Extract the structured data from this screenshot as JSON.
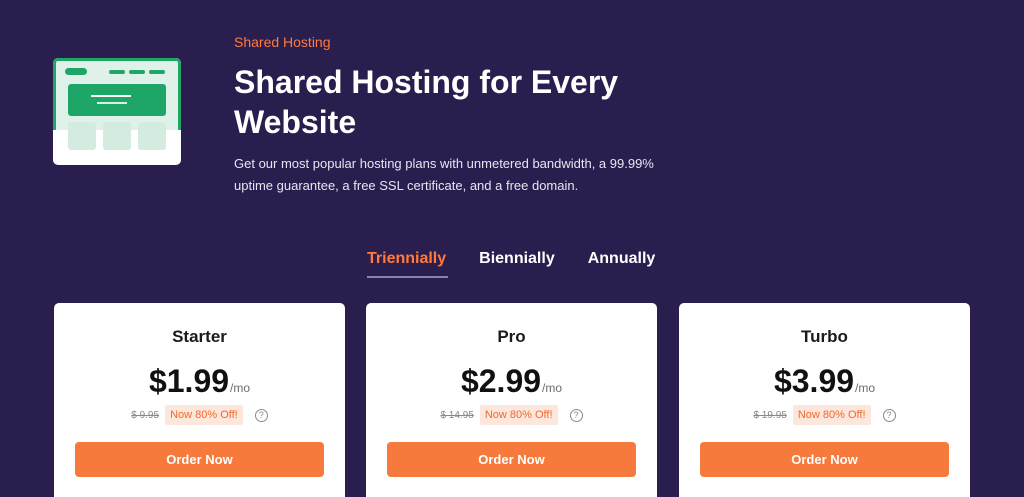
{
  "hero": {
    "eyebrow": "Shared Hosting",
    "title": "Shared Hosting for Every Website",
    "description": "Get our most popular hosting plans with unmetered bandwidth, a 99.99% uptime guarantee, a free SSL certificate, and a free domain.",
    "illustration_icon": "website-layout-illustration"
  },
  "tabs": [
    {
      "label": "Triennially",
      "active": true
    },
    {
      "label": "Biennially",
      "active": false
    },
    {
      "label": "Annually",
      "active": false
    }
  ],
  "plans": [
    {
      "name": "Starter",
      "price": "$1.99",
      "per": "/mo",
      "old_price": "$ 9.95",
      "badge": "Now 80% Off!",
      "button": "Order Now"
    },
    {
      "name": "Pro",
      "price": "$2.99",
      "per": "/mo",
      "old_price": "$ 14.95",
      "badge": "Now 80% Off!",
      "button": "Order Now"
    },
    {
      "name": "Turbo",
      "price": "$3.99",
      "per": "/mo",
      "old_price": "$ 19.95",
      "badge": "Now 80% Off!",
      "button": "Order Now"
    }
  ],
  "colors": {
    "background": "#2a1e4f",
    "accent": "#ff7a3c",
    "button": "#f57a3b",
    "illustration": "#1ea669"
  }
}
